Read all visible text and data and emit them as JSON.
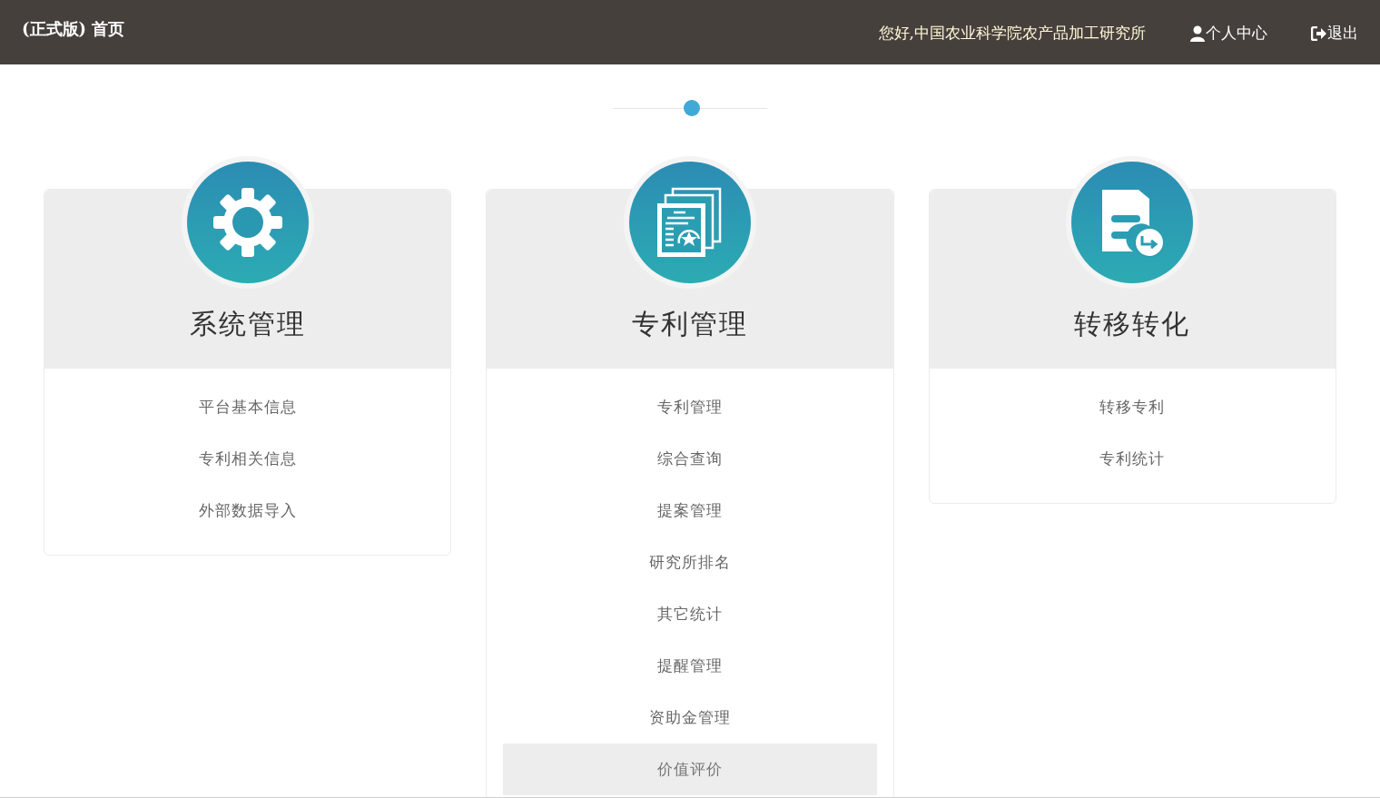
{
  "header": {
    "title": "(正式版) 首页",
    "greeting": "您好,中国农业科学院农产品加工研究所",
    "personal_center": "个人中心",
    "logout": "退出"
  },
  "modules": [
    {
      "kind": "gear",
      "title": "系统管理",
      "items": [
        {
          "label": "平台基本信息",
          "selected": false
        },
        {
          "label": "专利相关信息",
          "selected": false
        },
        {
          "label": "外部数据导入",
          "selected": false
        }
      ]
    },
    {
      "kind": "documents",
      "title": "专利管理",
      "items": [
        {
          "label": "专利管理",
          "selected": false
        },
        {
          "label": "综合查询",
          "selected": false
        },
        {
          "label": "提案管理",
          "selected": false
        },
        {
          "label": "研究所排名",
          "selected": false
        },
        {
          "label": "其它统计",
          "selected": false
        },
        {
          "label": "提醒管理",
          "selected": false
        },
        {
          "label": "资助金管理",
          "selected": false
        },
        {
          "label": "价值评价",
          "selected": true
        }
      ]
    },
    {
      "kind": "transfer",
      "title": "转移转化",
      "items": [
        {
          "label": "转移专利",
          "selected": false
        },
        {
          "label": "专利统计",
          "selected": false
        }
      ]
    }
  ]
}
